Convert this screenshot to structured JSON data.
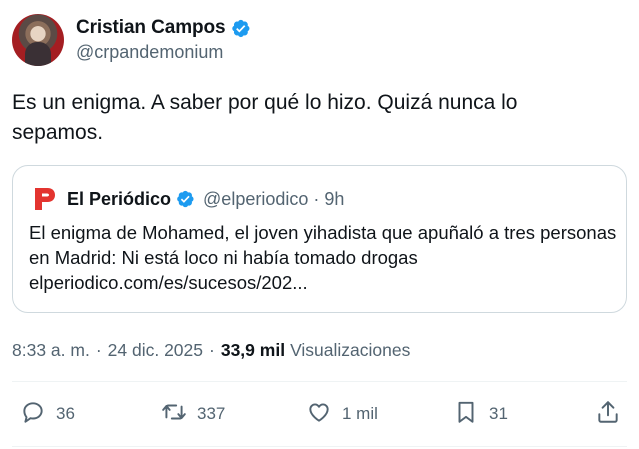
{
  "author": {
    "display_name": "Cristian Campos",
    "handle": "@crpandemonium",
    "verified": true
  },
  "tweet": {
    "text": "Es un enigma. A saber por qué lo hizo. Quizá nunca lo sepamos."
  },
  "quoted": {
    "display_name": "El Periódico",
    "handle": "@elperiodico",
    "separator": "·",
    "time": "9h",
    "text": "El enigma de Mohamed, el joven yihadista que apuñaló a tres personas en Madrid: Ni está loco ni había tomado drogas",
    "link": "elperiodico.com/es/sucesos/202..."
  },
  "meta": {
    "time": "8:33 a. m.",
    "separator": "·",
    "date": "24 dic. 2025",
    "separator2": "·",
    "views_count": "33,9 mil",
    "views_label": "Visualizaciones"
  },
  "actions": {
    "reply": {
      "icon": "reply-icon",
      "count": "36"
    },
    "retweet": {
      "icon": "retweet-icon",
      "count": "337"
    },
    "like": {
      "icon": "heart-icon",
      "count": "1 mil"
    },
    "bookmark": {
      "icon": "bookmark-icon",
      "count": "31"
    },
    "share": {
      "icon": "share-icon"
    }
  },
  "colors": {
    "verified_blue": "#1d9bf0",
    "periodico_red": "#e3342f",
    "text_secondary": "#536471",
    "border": "#cfd9de"
  }
}
